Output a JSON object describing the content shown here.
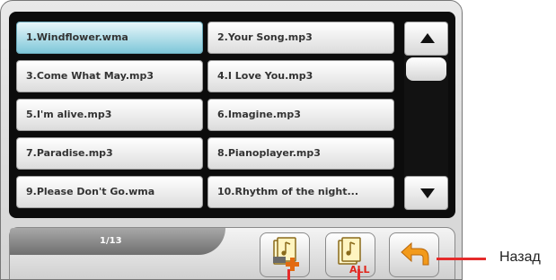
{
  "playlist": {
    "items": [
      {
        "label": "1.Windflower.wma",
        "selected": true
      },
      {
        "label": "2.Your Song.mp3",
        "selected": false
      },
      {
        "label": "3.Come What May.mp3",
        "selected": false
      },
      {
        "label": "4.I Love You.mp3",
        "selected": false
      },
      {
        "label": "5.I'm alive.mp3",
        "selected": false
      },
      {
        "label": "6.Imagine.mp3",
        "selected": false
      },
      {
        "label": "7.Paradise.mp3",
        "selected": false
      },
      {
        "label": "8.Pianoplayer.mp3",
        "selected": false
      },
      {
        "label": "9.Please Don't Go.wma",
        "selected": false
      },
      {
        "label": "10.Rhythm of the night...",
        "selected": false
      }
    ],
    "selected_color": "#7fc7d9"
  },
  "scrollbar": {
    "up_icon": "triangle-up-icon",
    "down_icon": "triangle-down-icon"
  },
  "pager": {
    "text": "1/13",
    "current_page": 1,
    "total_pages": 13
  },
  "toolbar": {
    "add_icon": "add-to-playlist-icon",
    "add_all_icon": "add-all-icon",
    "add_all_text": "ALL",
    "back_icon": "back-arrow-icon"
  },
  "annotations": {
    "back_label": "Назад",
    "callout_color": "#e52b2b"
  }
}
